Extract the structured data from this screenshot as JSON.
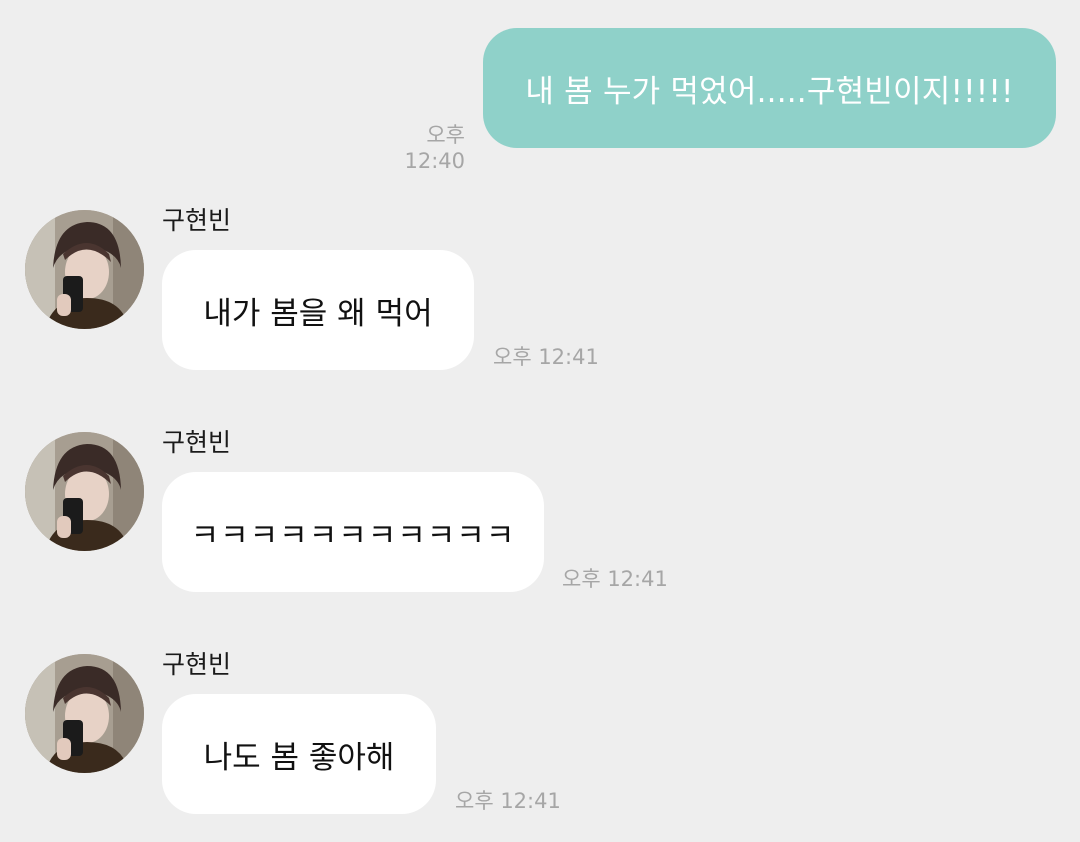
{
  "outgoing": {
    "text": "내 봄 누가 먹었어.....구현빈이지!!!!!",
    "time": "오후 12:40",
    "bubble_color": "#8fd1c9"
  },
  "incoming": [
    {
      "sender": "구현빈",
      "text": "내가 봄을 왜 먹어",
      "time": "오후 12:41"
    },
    {
      "sender": "구현빈",
      "text": "ㅋㅋㅋㅋㅋㅋㅋㅋㅋㅋㅋ",
      "time": "오후 12:41"
    },
    {
      "sender": "구현빈",
      "text": "나도 봄 좋아해",
      "time": "오후 12:41"
    }
  ],
  "colors": {
    "background": "#eeeeee",
    "incoming_bubble": "#ffffff",
    "timestamp": "#a6a6a6"
  },
  "icons": {
    "avatar": "profile-photo-avatar"
  }
}
